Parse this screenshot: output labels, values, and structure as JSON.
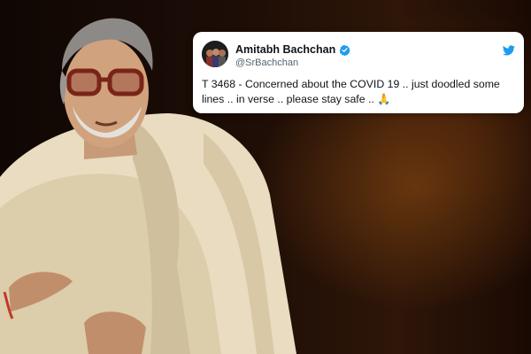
{
  "tweet": {
    "display_name": "Amitabh Bachchan",
    "handle": "@SrBachchan",
    "text_line1": "T 3468 - Concerned about the COVID 19 .. just doodled some",
    "text_line2": "lines .. in verse .. please stay safe ..",
    "emoji": "🙏",
    "icons": [
      "verified-badge-icon",
      "twitter-bird-icon"
    ]
  },
  "colors": {
    "verified_blue": "#1d9bf0",
    "twitter_blue": "#1d9bf0",
    "background": "#1d0d06",
    "card": "#ffffff"
  }
}
